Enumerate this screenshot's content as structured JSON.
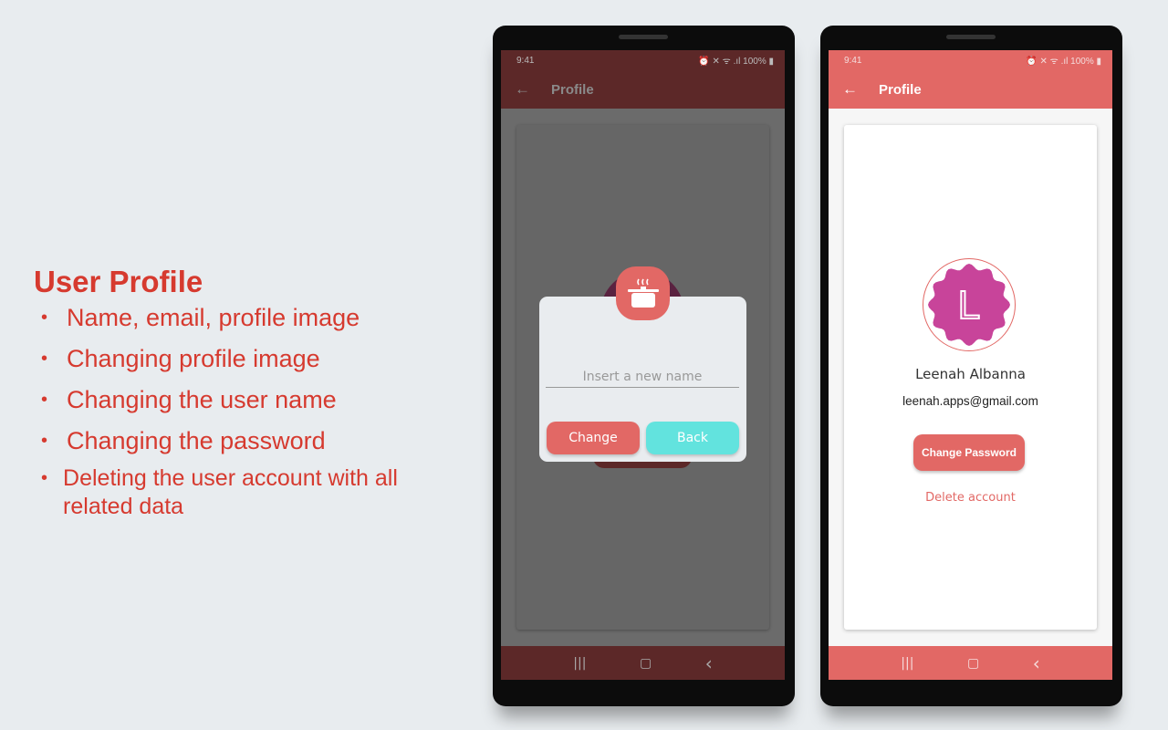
{
  "heading": "User Profile",
  "bullets": [
    "Name, email, profile image",
    "Changing profile image",
    "Changing the user name",
    "Changing the password",
    "Deleting the user account with all related data"
  ],
  "status": {
    "time": "9:41",
    "icons": "⏰ ✕ ᯤ .ıl",
    "battery": "100%"
  },
  "appbar": {
    "title": "Profile",
    "back_icon": "←"
  },
  "navbar": {
    "recent": "|||",
    "home": "▢",
    "back": "‹"
  },
  "dialog": {
    "placeholder": "Insert a new name",
    "change_label": "Change",
    "back_label": "Back",
    "icon": "cooking-pot-icon"
  },
  "profile": {
    "avatar_letter": "L",
    "name": "Leenah Albanna",
    "email": "leenah.apps@gmail.com",
    "change_password": "Change Password",
    "delete_account": "Delete account"
  },
  "colors": {
    "accent": "#e26865",
    "dim_bar": "#5c2828",
    "teal": "#62e3de",
    "avatar": "#c8449a",
    "heading": "#d63a2f"
  }
}
